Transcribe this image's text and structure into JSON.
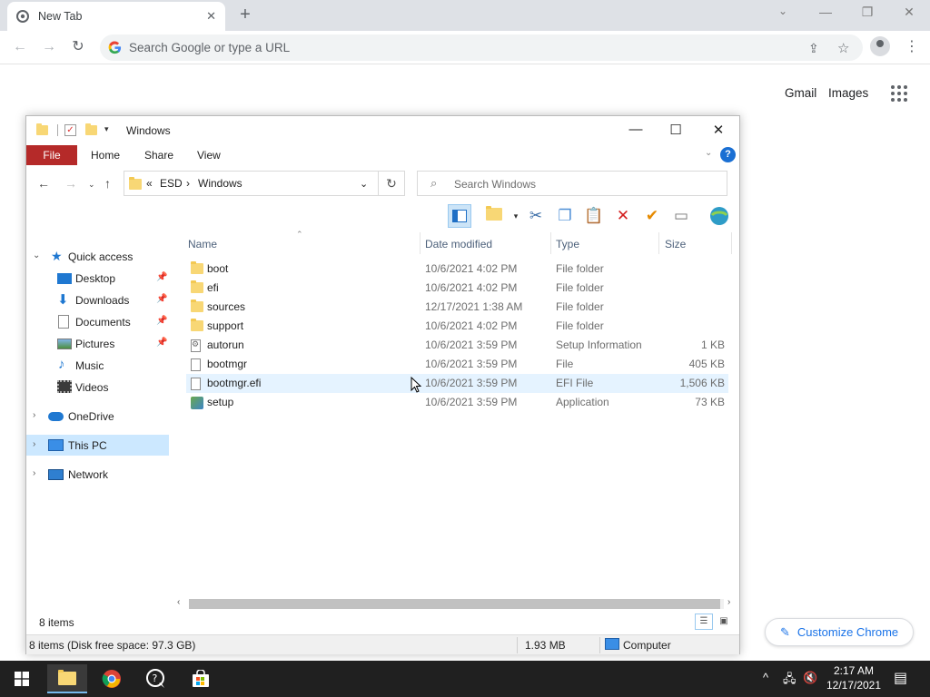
{
  "chrome": {
    "tab_title": "New Tab",
    "tab_close": "✕",
    "new_tab": "+",
    "omnibox_placeholder": "Search Google or type a URL",
    "ntp_links": [
      "Gmail",
      "Images"
    ],
    "customize_label": "Customize Chrome",
    "icons": {
      "back": "←",
      "forward": "→",
      "reload": "↻",
      "share": "⇪",
      "star": "☆",
      "kebab": "⋮",
      "tab_list": "⌄",
      "minimize": "—",
      "restore": "❐",
      "close": "✕",
      "pencil": "✎"
    }
  },
  "explorer": {
    "title": "Windows",
    "ribbon_tabs": [
      "File",
      "Home",
      "Share",
      "View"
    ],
    "help": "?",
    "breadcrumb": {
      "overflow": "«",
      "root": "ESD",
      "sep": "›",
      "current": "Windows"
    },
    "search_placeholder": "Search Windows",
    "nav_pane": [
      {
        "label": "Quick access",
        "expander": "⌄"
      },
      {
        "label": "Desktop",
        "pinned": true
      },
      {
        "label": "Downloads",
        "pinned": true
      },
      {
        "label": "Documents",
        "pinned": true
      },
      {
        "label": "Pictures",
        "pinned": true
      },
      {
        "label": "Music"
      },
      {
        "label": "Videos"
      },
      {
        "label": "OneDrive",
        "expander": "›"
      },
      {
        "label": "This PC",
        "expander": "›",
        "selected": true
      },
      {
        "label": "Network",
        "expander": "›"
      }
    ],
    "columns": [
      "Name",
      "Date modified",
      "Type",
      "Size"
    ],
    "files": [
      {
        "name": "boot",
        "date": "10/6/2021 4:02 PM",
        "type": "File folder",
        "size": "",
        "icon": "folder"
      },
      {
        "name": "efi",
        "date": "10/6/2021 4:02 PM",
        "type": "File folder",
        "size": "",
        "icon": "folder"
      },
      {
        "name": "sources",
        "date": "12/17/2021 1:38 AM",
        "type": "File folder",
        "size": "",
        "icon": "folder"
      },
      {
        "name": "support",
        "date": "10/6/2021 4:02 PM",
        "type": "File folder",
        "size": "",
        "icon": "folder"
      },
      {
        "name": "autorun",
        "date": "10/6/2021 3:59 PM",
        "type": "Setup Information",
        "size": "1 KB",
        "icon": "setup-info"
      },
      {
        "name": "bootmgr",
        "date": "10/6/2021 3:59 PM",
        "type": "File",
        "size": "405 KB",
        "icon": "file"
      },
      {
        "name": "bootmgr.efi",
        "date": "10/6/2021 3:59 PM",
        "type": "EFI File",
        "size": "1,506 KB",
        "icon": "file",
        "hover": true
      },
      {
        "name": "setup",
        "date": "10/6/2021 3:59 PM",
        "type": "Application",
        "size": "73 KB",
        "icon": "application"
      }
    ],
    "items_count": "8 items",
    "status": {
      "left": "8 items (Disk free space: 97.3 GB)",
      "size": "1.93 MB",
      "location": "Computer"
    }
  },
  "taskbar": {
    "time": "2:17 AM",
    "date": "12/17/2021",
    "tray_chevron": "^",
    "notification": "▤"
  },
  "colors": {
    "file_tab": "#b52a29",
    "selection": "#cce8ff",
    "hover": "#e5f3ff",
    "accent": "#1a73e8"
  }
}
